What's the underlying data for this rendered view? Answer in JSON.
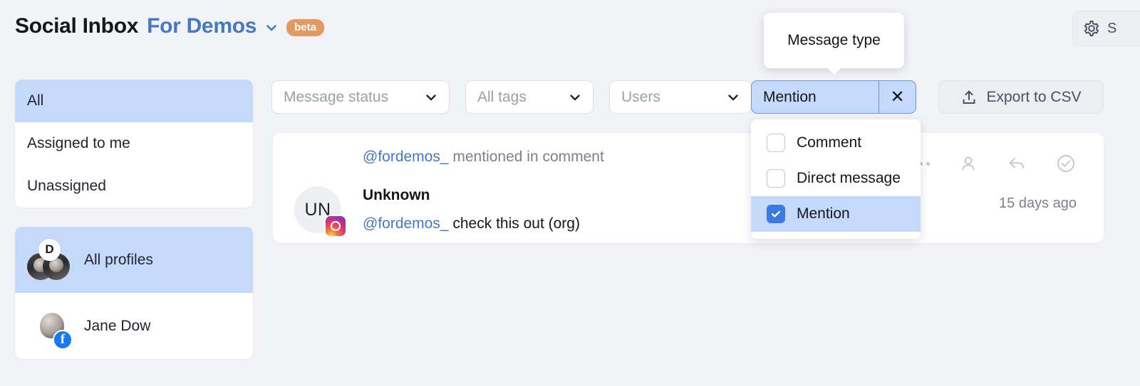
{
  "header": {
    "app_title": "Social Inbox",
    "workspace": "For Demos",
    "workspace_chevron_icon": "chevron-down-icon",
    "beta_badge": "beta",
    "settings_label": "S",
    "settings_icon": "gear-icon",
    "accent_blue": "#4478c4",
    "beta_color": "#e09a62"
  },
  "sidebar": {
    "filters": [
      {
        "label": "All",
        "active": true
      },
      {
        "label": "Assigned to me",
        "active": false
      },
      {
        "label": "Unassigned",
        "active": false
      }
    ],
    "profiles": [
      {
        "label": "All profiles",
        "active": true,
        "badge": "D",
        "avatar": "stacked-avatars"
      },
      {
        "label": "Jane Dow",
        "active": false,
        "network": "facebook-badge",
        "network_glyph": "f",
        "avatar": "person-photo"
      }
    ]
  },
  "toolbar": {
    "message_status": {
      "placeholder": "Message status",
      "chevron_icon": "chevron-down-icon"
    },
    "all_tags": {
      "placeholder": "All tags",
      "chevron_icon": "chevron-down-icon"
    },
    "users": {
      "placeholder": "Users",
      "chevron_icon": "chevron-down-icon"
    },
    "message_type_chip": {
      "value": "Mention",
      "clear_icon": "close-icon",
      "clear_glyph": "✕",
      "fill": "#c5dafa",
      "border": "#6b96d8"
    },
    "export": {
      "label": "Export to CSV",
      "icon": "upload-icon"
    }
  },
  "tooltip": {
    "text": "Message type"
  },
  "dropdown": {
    "options": [
      {
        "label": "Comment",
        "checked": false
      },
      {
        "label": "Direct message",
        "checked": false
      },
      {
        "label": "Mention",
        "checked": true
      }
    ],
    "checked_color": "#3b7ae0",
    "highlight_color": "#c5dafa"
  },
  "message": {
    "header_handle": "@fordemos_",
    "header_text": " mentioned in comment",
    "avatar_initials": "UN",
    "network_icon": "instagram-badge",
    "author": "Unknown",
    "body_handle": "@fordemos_",
    "body_text": " check this out (org)",
    "timestamp": "15 days ago",
    "actions": [
      {
        "name": "more-options-icon",
        "label": "..."
      },
      {
        "name": "assign-user-icon",
        "label": "assign"
      },
      {
        "name": "reply-icon",
        "label": "reply"
      },
      {
        "name": "mark-done-icon",
        "label": "done"
      }
    ]
  },
  "theme": {
    "background": "#f2f3f7",
    "card": "#ffffff"
  }
}
